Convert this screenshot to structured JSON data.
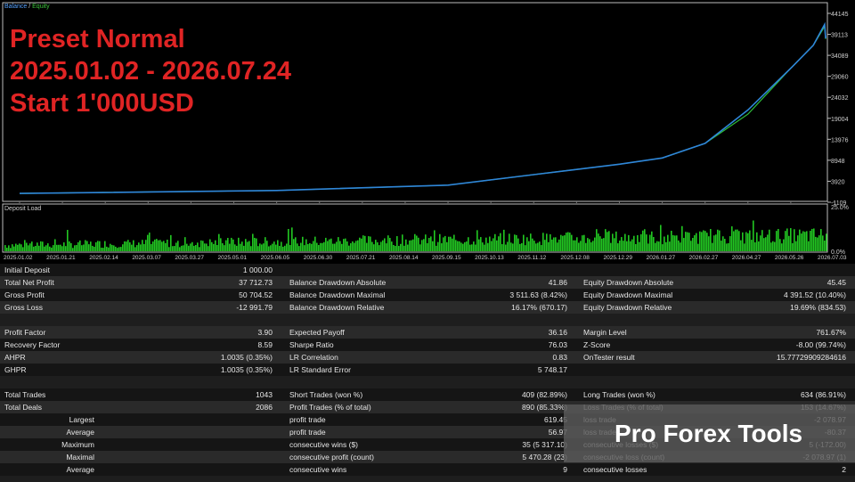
{
  "chart": {
    "legend_balance": "Balance",
    "legend_sep": " / ",
    "legend_equity": "Equity",
    "overlay": [
      "Preset Normal",
      "2025.01.02 - 2026.07.24",
      "Start 1'000USD"
    ],
    "y_ticks": [
      "44145",
      "39113",
      "34089",
      "29060",
      "24032",
      "19004",
      "13976",
      "8948",
      "3920",
      "-1109"
    ],
    "deposit_label": "Deposit Load",
    "load_ticks": [
      "25.0%",
      "0.0%"
    ],
    "x_ticks": [
      "2025.01.02",
      "2025.01.21",
      "2025.02.14",
      "2025.03.07",
      "2025.03.27",
      "2025.05.01",
      "2025.06.05",
      "2025.06.30",
      "2025.07.21",
      "2025.08.14",
      "2025.09.15",
      "2025.10.13",
      "2025.11.12",
      "2025.12.08",
      "2025.12.29",
      "2026.01.27",
      "2026.02.27",
      "2026.04.27",
      "2026.05.26",
      "2026.07.03"
    ],
    "colors": {
      "balance": "#2f86d9",
      "equity": "#2fbf3a",
      "grid": "#3a3a3a",
      "load": "#22c722"
    }
  },
  "chart_data": {
    "type": "line",
    "x": [
      "2025.01.02",
      "2025.06.05",
      "2025.09.15",
      "2025.11.12",
      "2025.12.29",
      "2026.01.27",
      "2026.02.27",
      "2026.04.27",
      "2026.05.26",
      "2026.06.15",
      "2026.06.25",
      "2026.07.03",
      "2026.07.24"
    ],
    "series": [
      {
        "name": "Balance",
        "values": [
          1000,
          1700,
          3000,
          5500,
          8000,
          9500,
          13000,
          21000,
          31000,
          36500,
          41500,
          38200,
          38700
        ]
      },
      {
        "name": "Equity",
        "values": [
          1000,
          1700,
          3000,
          5500,
          8000,
          9500,
          13000,
          20000,
          31000,
          36500,
          41000,
          38000,
          38700
        ]
      }
    ],
    "ylim": [
      -1109,
      44145
    ]
  },
  "stats": {
    "rows": [
      [
        "Initial Deposit",
        "1 000.00",
        "",
        "",
        "",
        ""
      ],
      [
        "Total Net Profit",
        "37 712.73",
        "Balance Drawdown Absolute",
        "41.86",
        "Equity Drawdown Absolute",
        "45.45"
      ],
      [
        "Gross Profit",
        "50 704.52",
        "Balance Drawdown Maximal",
        "3 511.63 (8.42%)",
        "Equity Drawdown Maximal",
        "4 391.52 (10.40%)"
      ],
      [
        "Gross Loss",
        "-12 991.79",
        "Balance Drawdown Relative",
        "16.17% (670.17)",
        "Equity Drawdown Relative",
        "19.69% (834.53)"
      ],
      [
        "",
        "",
        "",
        "",
        "",
        ""
      ],
      [
        "Profit Factor",
        "3.90",
        "Expected Payoff",
        "36.16",
        "Margin Level",
        "761.67%"
      ],
      [
        "Recovery Factor",
        "8.59",
        "Sharpe Ratio",
        "76.03",
        "Z-Score",
        "-8.00 (99.74%)"
      ],
      [
        "AHPR",
        "1.0035 (0.35%)",
        "LR Correlation",
        "0.83",
        "OnTester result",
        "15.77729909284616"
      ],
      [
        "GHPR",
        "1.0035 (0.35%)",
        "LR Standard Error",
        "5 748.17",
        "",
        ""
      ],
      [
        "",
        "",
        "",
        "",
        "",
        ""
      ],
      [
        "Total Trades",
        "1043",
        "Short Trades (won %)",
        "409 (82.89%)",
        "Long Trades (won %)",
        "634 (86.91%)"
      ],
      [
        "Total Deals",
        "2086",
        "Profit Trades (% of total)",
        "890 (85.33%)",
        "Loss Trades (% of total)",
        "153 (14.67%)"
      ],
      [
        "Largest",
        "",
        "profit trade",
        "619.45",
        "loss trade",
        "-2 078.97"
      ],
      [
        "Average",
        "",
        "profit trade",
        "56.97",
        "loss trade",
        "-80.37"
      ],
      [
        "Maximum",
        "",
        "consecutive wins ($)",
        "35 (5 317.10)",
        "consecutive losses ($)",
        "5 (-172.00)"
      ],
      [
        "Maximal",
        "",
        "consecutive profit (count)",
        "5 470.28 (23)",
        "consecutive loss (count)",
        "-2 078.97 (1)"
      ],
      [
        "Average",
        "",
        "consecutive wins",
        "9",
        "consecutive losses",
        "2"
      ]
    ]
  },
  "watermark": "Pro Forex Tools"
}
